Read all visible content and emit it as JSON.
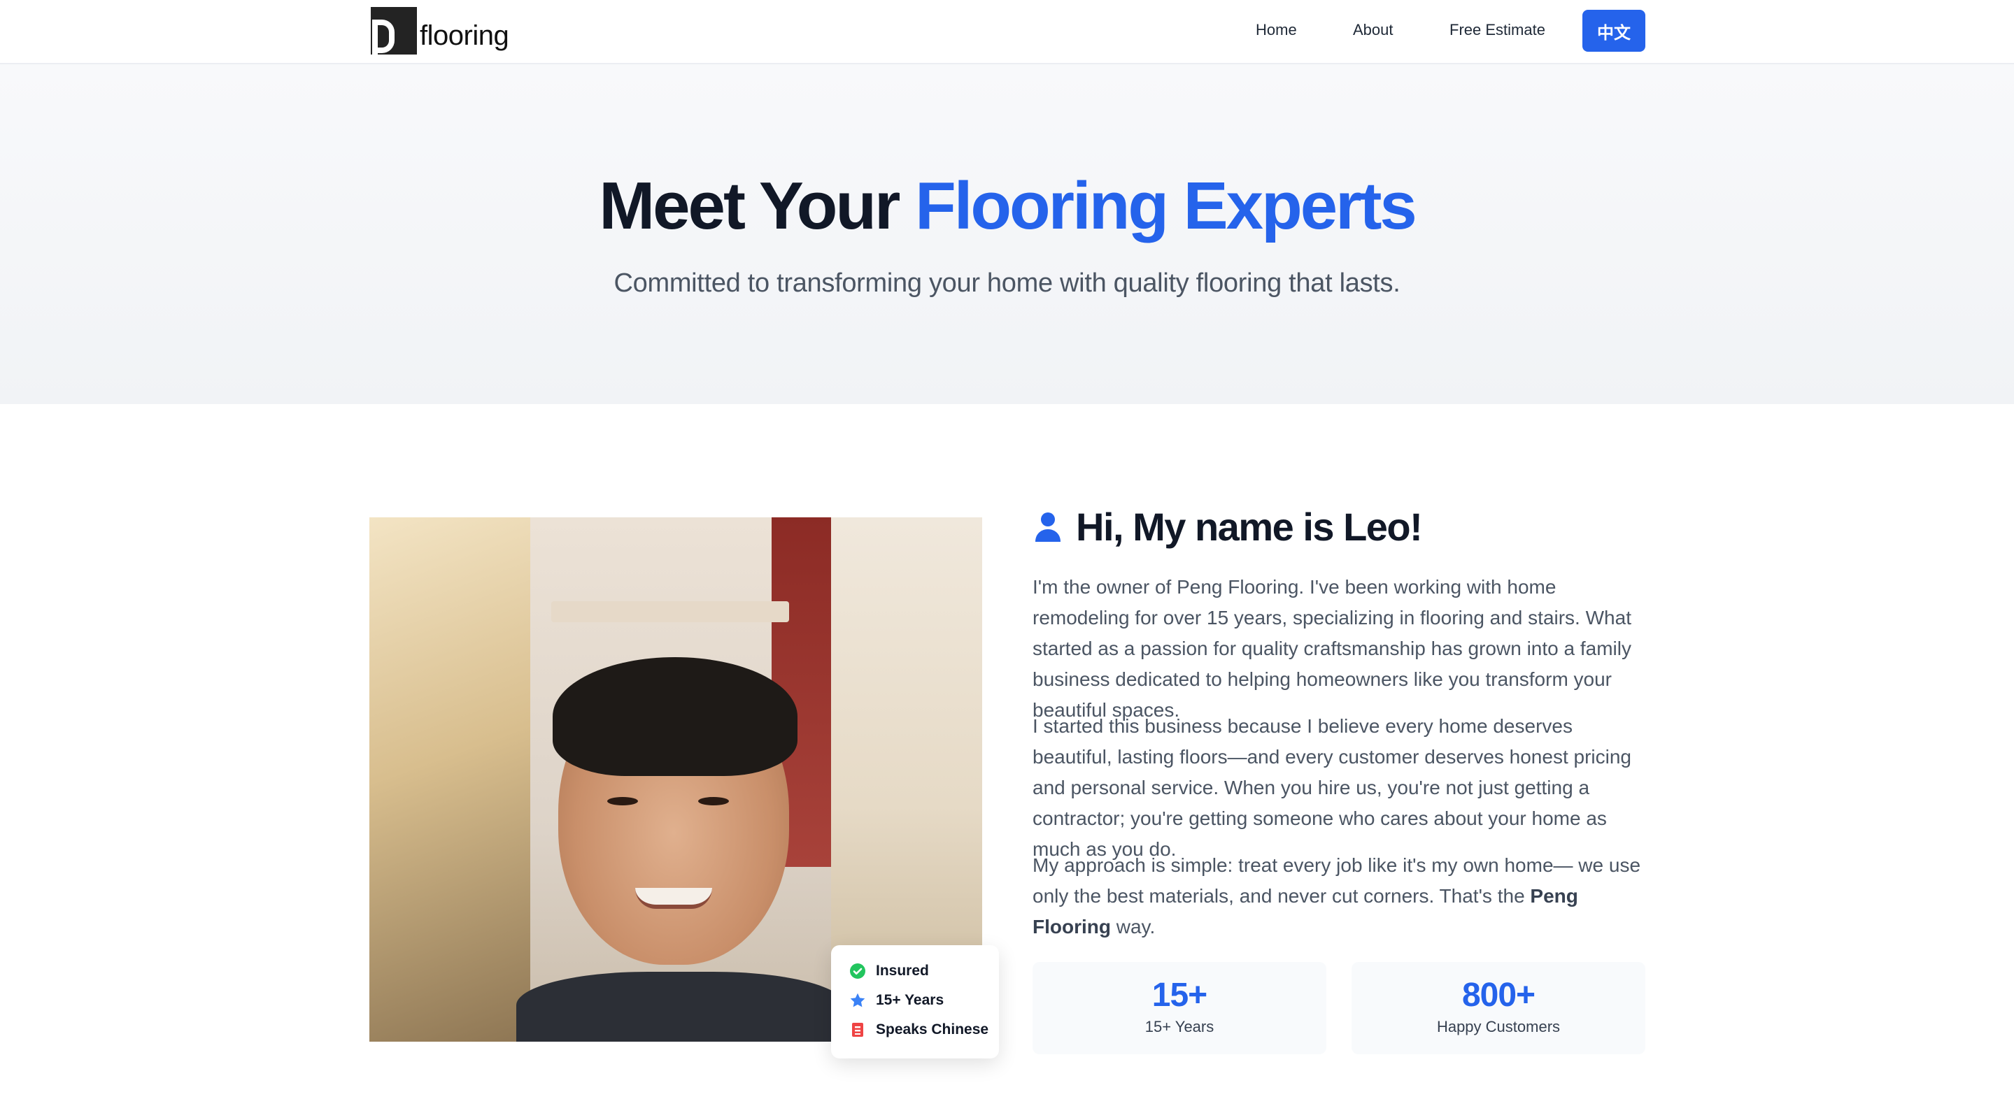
{
  "nav": {
    "logo_text": "flooring",
    "links": [
      {
        "label": "Home"
      },
      {
        "label": "About"
      },
      {
        "label": "Free Estimate"
      }
    ],
    "language_button": "中文",
    "accent_color": "#2563eb"
  },
  "hero": {
    "title_part1": "Meet Your ",
    "title_accent": "Flooring Experts",
    "subtitle": "Committed to transforming your home with quality flooring that lasts."
  },
  "about": {
    "photo_alt": "Leo, owner of Peng Flooring",
    "badges": [
      {
        "icon": "check-circle-icon",
        "label": "Insured",
        "color": "#22c55e"
      },
      {
        "icon": "star-icon",
        "label": "15+ Years",
        "color": "#3b82f6"
      },
      {
        "icon": "language-icon",
        "label": "Speaks Chinese",
        "color": "#ef4444"
      }
    ],
    "greeting": "Hi, My name is Leo!",
    "paragraph1": "I'm the owner of Peng Flooring. I've been working with home remodeling for over 15 years, specializing in flooring and stairs. What started as a passion for quality craftsmanship has grown into a family business dedicated to helping homeowners like you transform your beautiful spaces.",
    "paragraph2": "I started this business because I believe every home deserves beautiful, lasting floors—and every customer deserves honest pricing and personal service. When you hire us, you're not just getting a contractor; you're getting someone who cares about your home as much as you do.",
    "paragraph3_before": "My approach is simple: treat every job like it's my own home— we use only the best materials, and never cut corners. That's the ",
    "paragraph3_bold": "Peng Flooring",
    "paragraph3_after": " way.",
    "stats": [
      {
        "value": "15+",
        "label": "15+ Years"
      },
      {
        "value": "800+",
        "label": "Happy Customers"
      }
    ]
  }
}
